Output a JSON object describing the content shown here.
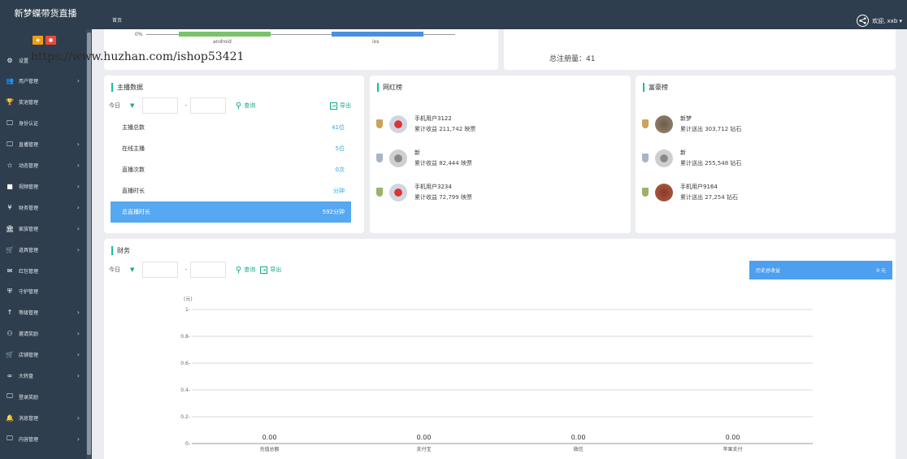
{
  "header": {
    "brand": "新梦蝶带货直播",
    "home_tab": "首页",
    "user": "欢迎, xxb ▾"
  },
  "sidebar": {
    "items": [
      {
        "label": "设置",
        "icon": "gears-icon",
        "glyph": "⚙",
        "arrow": false
      },
      {
        "label": "用户管理",
        "icon": "users-icon",
        "glyph": "👥",
        "arrow": true
      },
      {
        "label": "奖池管理",
        "icon": "trophy-icon",
        "glyph": "🏆",
        "arrow": false
      },
      {
        "label": "身份认证",
        "icon": "monitor-icon",
        "glyph": "🖵",
        "arrow": false
      },
      {
        "label": "直播管理",
        "icon": "monitor-icon",
        "glyph": "🖵",
        "arrow": true
      },
      {
        "label": "动态管理",
        "icon": "star-icon",
        "glyph": "☆",
        "arrow": true
      },
      {
        "label": "视频管理",
        "icon": "video-icon",
        "glyph": "■",
        "arrow": true
      },
      {
        "label": "财务管理",
        "icon": "yen-icon",
        "glyph": "¥",
        "arrow": true
      },
      {
        "label": "家族管理",
        "icon": "bank-icon",
        "glyph": "🏛",
        "arrow": true
      },
      {
        "label": "道具管理",
        "icon": "cart-icon",
        "glyph": "🛒",
        "arrow": true
      },
      {
        "label": "红包管理",
        "icon": "envelope-icon",
        "glyph": "✉",
        "arrow": false
      },
      {
        "label": "守护管理",
        "icon": "shield-icon",
        "glyph": "⛨",
        "arrow": false
      },
      {
        "label": "等级管理",
        "icon": "level-icon",
        "glyph": "↑",
        "arrow": true
      },
      {
        "label": "邀请奖励",
        "icon": "org-icon",
        "glyph": "⚇",
        "arrow": true
      },
      {
        "label": "店铺管理",
        "icon": "cart-icon",
        "glyph": "🛒",
        "arrow": true
      },
      {
        "label": "大转盘",
        "icon": "wheel-icon",
        "glyph": "∞",
        "arrow": true
      },
      {
        "label": "登录奖励",
        "icon": "monitor-icon",
        "glyph": "🖵",
        "arrow": false
      },
      {
        "label": "消息管理",
        "icon": "bell-icon",
        "glyph": "🔔",
        "arrow": true
      },
      {
        "label": "内容管理",
        "icon": "monitor-icon",
        "glyph": "🖵",
        "arrow": true
      }
    ]
  },
  "watermark": "https://www.huzhan.com/ishop53421",
  "top_chart": {
    "zero_label": "0%",
    "labels": [
      "android",
      "ios"
    ]
  },
  "total_reg": "总注册量：41",
  "anchor": {
    "title": "主播数据",
    "filter_today": "今日",
    "query": "查询",
    "export": "导出",
    "rows": [
      {
        "label": "主播总数",
        "value": "41位"
      },
      {
        "label": "在线主播",
        "value": "5位"
      },
      {
        "label": "直播次数",
        "value": "0次"
      },
      {
        "label": "直播时长",
        "value": "分钟"
      },
      {
        "label": "总直播时长",
        "value": "592分钟"
      }
    ]
  },
  "influencers": {
    "title": "网红榜",
    "items": [
      {
        "name": "手机用户3122",
        "sub": "累计收益 211,742 映票"
      },
      {
        "name": "新",
        "sub": "累计收益 82,444 映票"
      },
      {
        "name": "手机用户3234",
        "sub": "累计收益 72,799 映票"
      }
    ]
  },
  "richlist": {
    "title": "富豪榜",
    "items": [
      {
        "name": "新梦",
        "sub": "累计送出 303,712 钻石"
      },
      {
        "name": "新",
        "sub": "累计送出 255,548 钻石"
      },
      {
        "name": "手机用户9164",
        "sub": "累计送出 27,254 钻石"
      }
    ]
  },
  "finance": {
    "title": "财务",
    "filter_today": "今日",
    "query": "查询",
    "export": "导出",
    "total_label": "历史总收益",
    "total_value": "0 元"
  },
  "chart_data": {
    "type": "bar",
    "categories": [
      "充值总额",
      "支付宝",
      "微信",
      "苹果支付"
    ],
    "values": [
      0,
      0,
      0,
      0
    ],
    "value_labels": [
      "0.00",
      "0.00",
      "0.00",
      "0.00"
    ],
    "ylabel": "(元)",
    "yticks": [
      "0-",
      "0.2-",
      "0.4-",
      "0.6-",
      "0.8-",
      "1-"
    ],
    "ylim": [
      0,
      1
    ],
    "grid": true
  },
  "colors": {
    "accent": "#1abc9c",
    "blue": "#55a8f1",
    "sidebar": "#2f3e4e"
  }
}
